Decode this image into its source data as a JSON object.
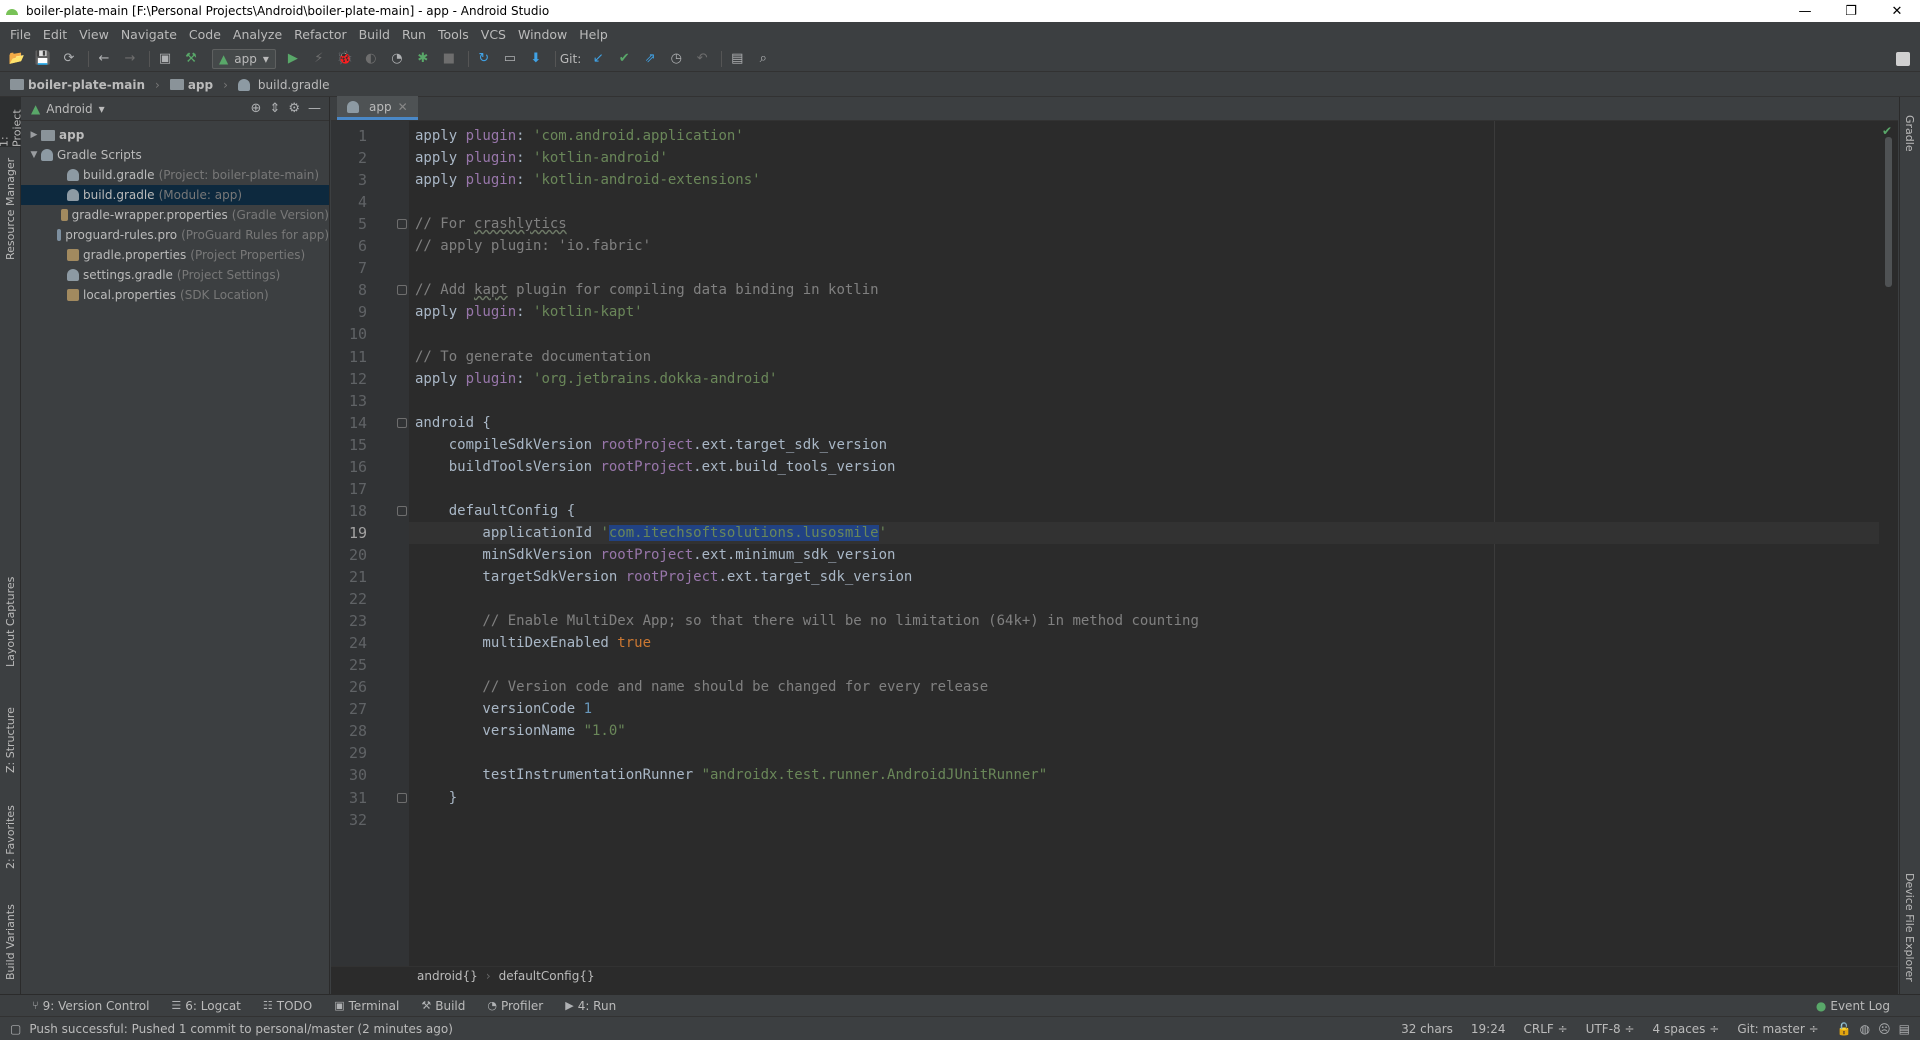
{
  "window": {
    "title": "boiler-plate-main [F:\\Personal Projects\\Android\\boiler-plate-main] - app - Android Studio",
    "controls": {
      "minimize": "—",
      "restore": "❐",
      "close": "✕"
    }
  },
  "menu": [
    "File",
    "Edit",
    "View",
    "Navigate",
    "Code",
    "Analyze",
    "Refactor",
    "Build",
    "Run",
    "Tools",
    "VCS",
    "Window",
    "Help"
  ],
  "toolbar": {
    "run_config": "app",
    "git_label": "Git:"
  },
  "breadcrumb": {
    "project": "boiler-plate-main",
    "module": "app",
    "file": "build.gradle"
  },
  "left_strip": {
    "project_tab": "1: Project",
    "resource_manager": "Resource Manager",
    "layout_captures": "Layout Captures",
    "structure": "Z: Structure",
    "favorites": "2: Favorites",
    "build_variants": "Build Variants"
  },
  "right_strip": {
    "gradle": "Gradle",
    "device_file_explorer": "Device File Explorer"
  },
  "project_panel": {
    "view_mode": "Android",
    "tree": [
      {
        "label": "app",
        "meta": "",
        "level": 0,
        "arrow": "▶",
        "kind": "folder"
      },
      {
        "label": "Gradle Scripts",
        "meta": "",
        "level": 0,
        "arrow": "▼",
        "kind": "gradle"
      },
      {
        "label": "build.gradle",
        "meta": "(Project: boiler-plate-main)",
        "level": 1,
        "arrow": "",
        "kind": "gradle"
      },
      {
        "label": "build.gradle",
        "meta": "(Module: app)",
        "level": 1,
        "arrow": "",
        "kind": "gradle",
        "selected": true
      },
      {
        "label": "gradle-wrapper.properties",
        "meta": "(Gradle Version)",
        "level": 1,
        "arrow": "",
        "kind": "props"
      },
      {
        "label": "proguard-rules.pro",
        "meta": "(ProGuard Rules for app)",
        "level": 1,
        "arrow": "",
        "kind": "pro"
      },
      {
        "label": "gradle.properties",
        "meta": "(Project Properties)",
        "level": 1,
        "arrow": "",
        "kind": "props"
      },
      {
        "label": "settings.gradle",
        "meta": "(Project Settings)",
        "level": 1,
        "arrow": "",
        "kind": "gradle"
      },
      {
        "label": "local.properties",
        "meta": "(SDK Location)",
        "level": 1,
        "arrow": "",
        "kind": "props"
      }
    ]
  },
  "editor": {
    "tab_label": "app",
    "current_line": 19,
    "line_numbers": [
      "1",
      "2",
      "3",
      "4",
      "5",
      "6",
      "7",
      "8",
      "9",
      "10",
      "11",
      "12",
      "13",
      "14",
      "15",
      "16",
      "17",
      "18",
      "19",
      "20",
      "21",
      "22",
      "23",
      "24",
      "25",
      "26",
      "27",
      "28",
      "29",
      "30",
      "31",
      "32"
    ],
    "code": [
      [
        {
          "t": "apply "
        },
        {
          "t": "plugin",
          "c": "prop"
        },
        {
          "t": ": "
        },
        {
          "t": "'com.android.application'",
          "c": "str"
        }
      ],
      [
        {
          "t": "apply "
        },
        {
          "t": "plugin",
          "c": "prop"
        },
        {
          "t": ": "
        },
        {
          "t": "'kotlin-android'",
          "c": "str"
        }
      ],
      [
        {
          "t": "apply "
        },
        {
          "t": "plugin",
          "c": "prop"
        },
        {
          "t": ": "
        },
        {
          "t": "'kotlin-android-extensions'",
          "c": "str"
        }
      ],
      [],
      [
        {
          "t": "// For ",
          "c": "cmt"
        },
        {
          "t": "crashlytics",
          "c": "cmt typo"
        }
      ],
      [
        {
          "t": "// apply plugin: 'io.fabric'",
          "c": "cmt"
        }
      ],
      [],
      [
        {
          "t": "// Add ",
          "c": "cmt"
        },
        {
          "t": "kapt",
          "c": "cmt typo"
        },
        {
          "t": " plugin for compiling data binding in kotlin",
          "c": "cmt"
        }
      ],
      [
        {
          "t": "apply "
        },
        {
          "t": "plugin",
          "c": "prop"
        },
        {
          "t": ": "
        },
        {
          "t": "'kotlin-kapt'",
          "c": "str"
        }
      ],
      [],
      [
        {
          "t": "// To generate documentation",
          "c": "cmt"
        }
      ],
      [
        {
          "t": "apply "
        },
        {
          "t": "plugin",
          "c": "prop"
        },
        {
          "t": ": "
        },
        {
          "t": "'org.jetbrains.dokka-android'",
          "c": "str"
        }
      ],
      [],
      [
        {
          "t": "android {"
        }
      ],
      [
        {
          "t": "    compileSdkVersion "
        },
        {
          "t": "rootProject",
          "c": "prop"
        },
        {
          "t": ".ext.target_sdk_version"
        }
      ],
      [
        {
          "t": "    buildToolsVersion "
        },
        {
          "t": "rootProject",
          "c": "prop"
        },
        {
          "t": ".ext.build_tools_version"
        }
      ],
      [],
      [
        {
          "t": "    defaultConfig {"
        }
      ],
      [
        {
          "t": "        applicationId "
        },
        {
          "t": "'",
          "c": "str"
        },
        {
          "t": "com.itechsoftsolutions.lusosmile",
          "c": "str sel"
        },
        {
          "t": "'",
          "c": "str"
        }
      ],
      [
        {
          "t": "        minSdkVersion "
        },
        {
          "t": "rootProject",
          "c": "prop"
        },
        {
          "t": ".ext.minimum_sdk_version"
        }
      ],
      [
        {
          "t": "        targetSdkVersion "
        },
        {
          "t": "rootProject",
          "c": "prop"
        },
        {
          "t": ".ext.target_sdk_version"
        }
      ],
      [],
      [
        {
          "t": "        // Enable MultiDex App; so that there will be no limitation (64k+) in method counting",
          "c": "cmt"
        }
      ],
      [
        {
          "t": "        multiDexEnabled "
        },
        {
          "t": "true",
          "c": "kw"
        }
      ],
      [],
      [
        {
          "t": "        // Version code and name should be changed for every release",
          "c": "cmt"
        }
      ],
      [
        {
          "t": "        versionCode "
        },
        {
          "t": "1",
          "c": "num"
        }
      ],
      [
        {
          "t": "        versionName "
        },
        {
          "t": "\"1.0\"",
          "c": "str"
        }
      ],
      [],
      [
        {
          "t": "        testInstrumentationRunner "
        },
        {
          "t": "\"androidx.test.runner.AndroidJUnitRunner\"",
          "c": "str"
        }
      ],
      [
        {
          "t": "    }"
        }
      ],
      []
    ],
    "structure_breadcrumb": [
      "android{}",
      "defaultConfig{}"
    ]
  },
  "bottom_tabs": [
    {
      "icon": "⑂",
      "label": "9: Version Control"
    },
    {
      "icon": "☰",
      "label": "6: Logcat"
    },
    {
      "icon": "☷",
      "label": "TODO"
    },
    {
      "icon": "▣",
      "label": "Terminal"
    },
    {
      "icon": "⚒",
      "label": "Build"
    },
    {
      "icon": "◔",
      "label": "Profiler"
    },
    {
      "icon": "▶",
      "label": "4: Run"
    }
  ],
  "event_log": "Event Log",
  "status": {
    "message": "Push successful: Pushed 1 commit to personal/master (2 minutes ago)",
    "chars": "32 chars",
    "position": "19:24",
    "line_sep": "CRLF ÷",
    "encoding": "UTF-8 ÷",
    "indent": "4 spaces ÷",
    "vcs_branch": "Git: master ÷"
  },
  "colors": {
    "editor_bg": "#2b2b2b",
    "panel_bg": "#3c3f41",
    "selection": "#214283",
    "string": "#6a8759",
    "comment": "#808080",
    "property": "#9876aa",
    "keyword": "#cc7832",
    "number": "#6897bb"
  }
}
